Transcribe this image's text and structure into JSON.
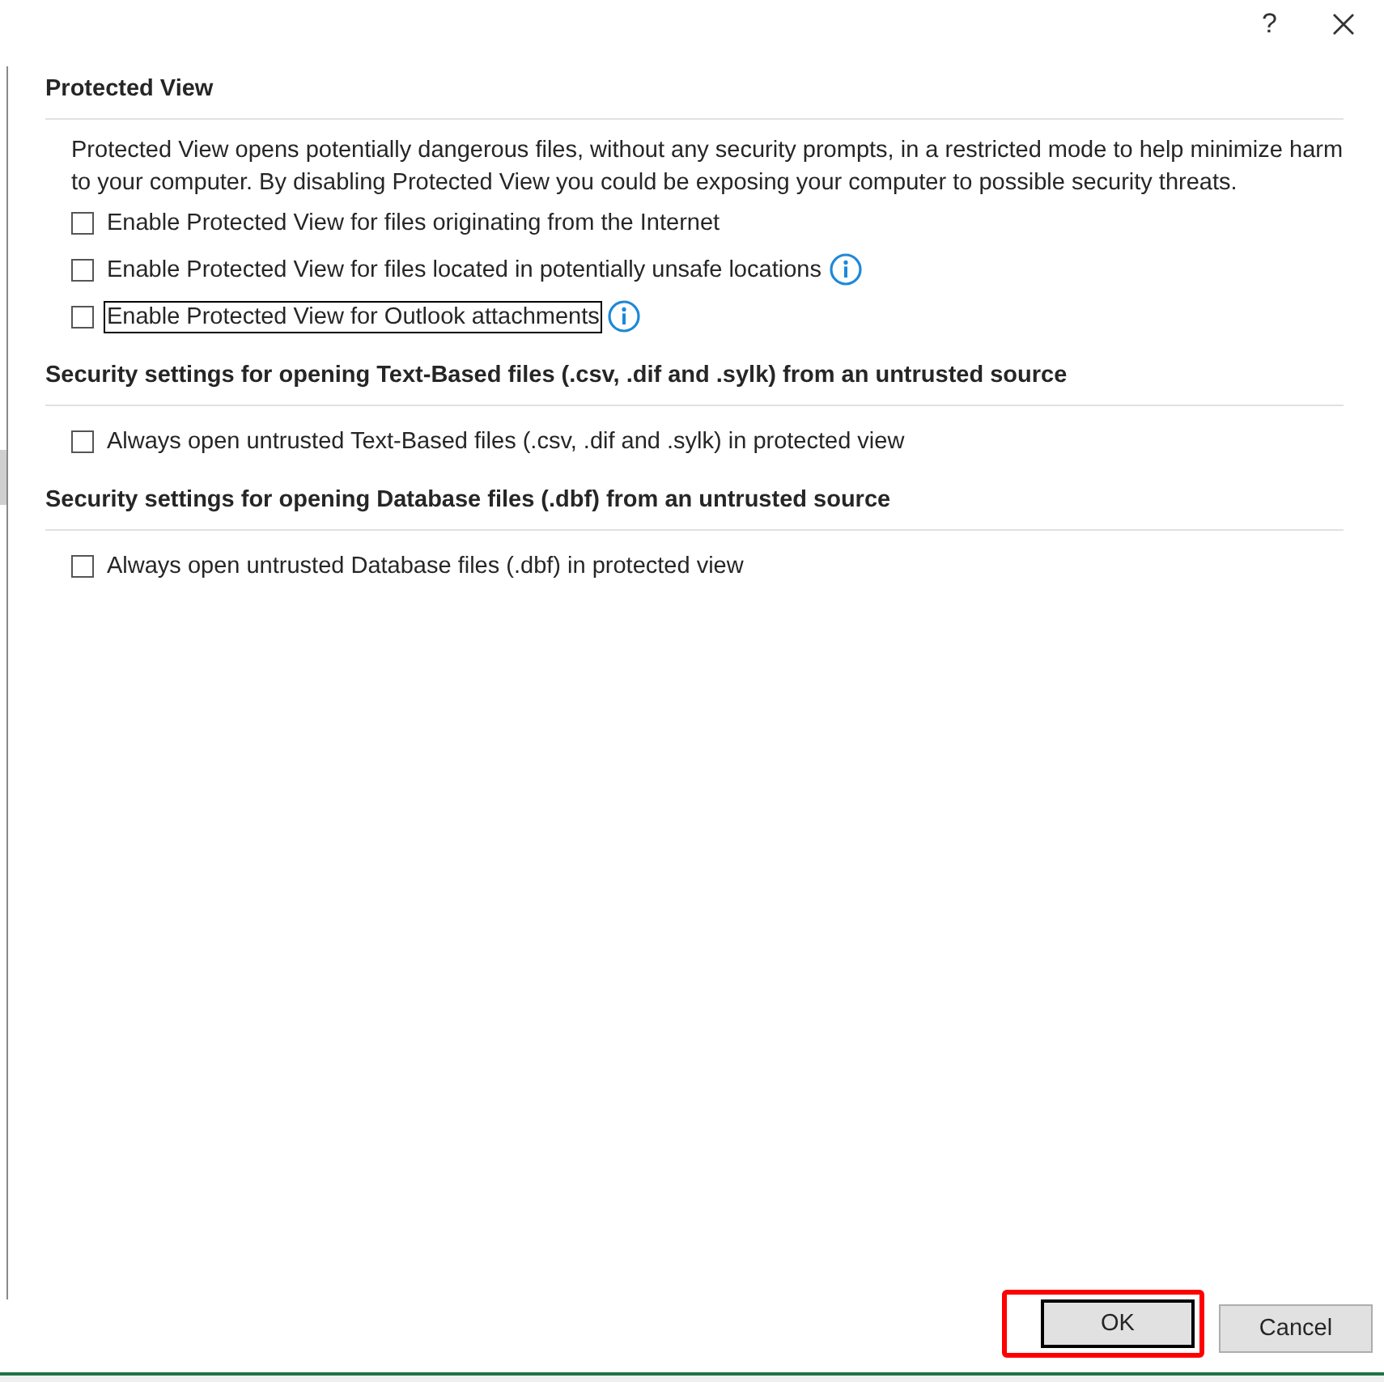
{
  "title_bar": {
    "help": "?"
  },
  "sections": [
    {
      "heading": "Protected View",
      "description": "Protected View opens potentially dangerous files, without any security prompts, in a restricted mode to help minimize harm to your computer. By disabling Protected View you could be exposing your computer to possible security threats.",
      "options": [
        {
          "label": "Enable Protected View for files originating from the Internet",
          "checked": false,
          "focused": false,
          "info": false
        },
        {
          "label": "Enable Protected View for files located in potentially unsafe locations",
          "checked": false,
          "focused": false,
          "info": true
        },
        {
          "label": "Enable Protected View for Outlook attachments",
          "checked": false,
          "focused": true,
          "info": true
        }
      ]
    },
    {
      "heading": "Security settings for opening Text-Based files (.csv, .dif and .sylk) from an untrusted source",
      "options": [
        {
          "label": "Always open untrusted Text-Based files (.csv, .dif and .sylk) in protected view",
          "checked": false,
          "focused": false,
          "info": false
        }
      ]
    },
    {
      "heading": "Security settings for opening Database files (.dbf) from an untrusted source",
      "options": [
        {
          "label": "Always open untrusted Database files (.dbf) in protected view",
          "checked": false,
          "focused": false,
          "info": false
        }
      ]
    }
  ],
  "buttons": [
    {
      "label": "OK",
      "kind": "default",
      "highlighted": true
    },
    {
      "label": "Cancel",
      "kind": "normal",
      "highlighted": false
    }
  ]
}
